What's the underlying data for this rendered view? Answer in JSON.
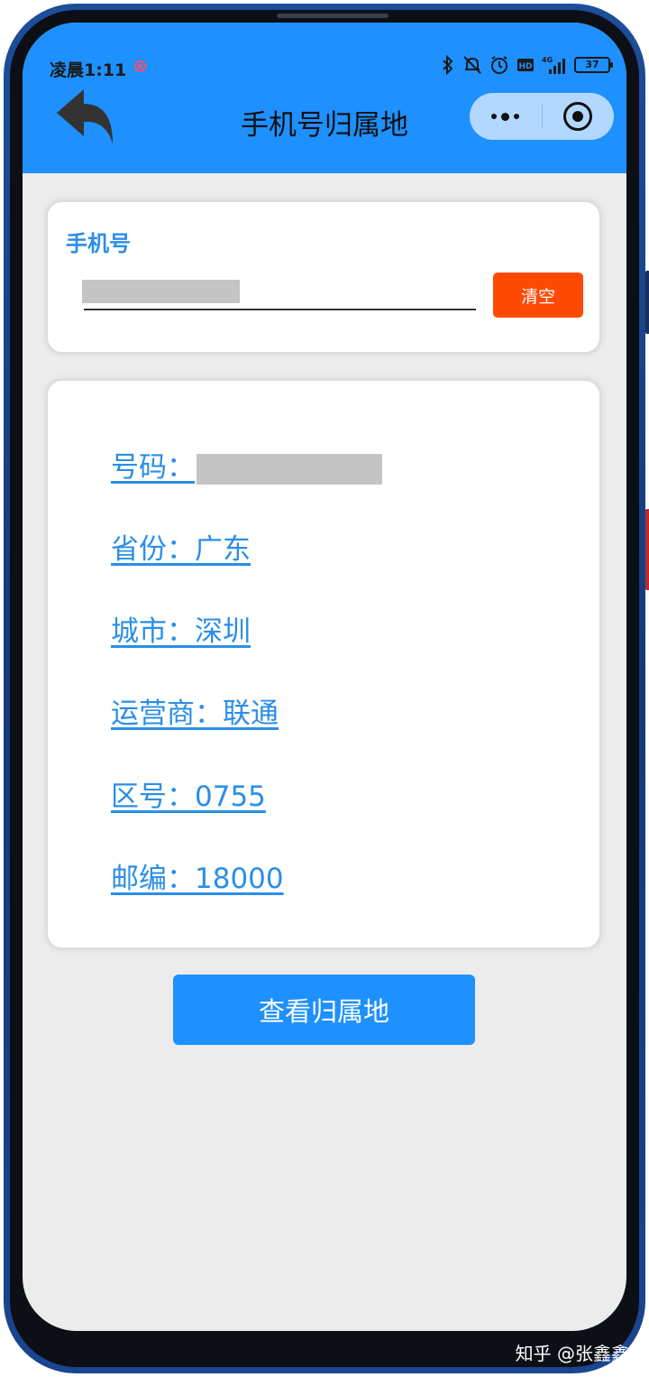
{
  "status_bar": {
    "time": "凌晨1:11",
    "battery": "37",
    "network": "4G",
    "icons": [
      "bluetooth-icon",
      "bell-off-icon",
      "alarm-icon",
      "hd-icon",
      "signal-icon",
      "battery-icon"
    ]
  },
  "nav": {
    "title": "手机号归属地",
    "back_icon": "back-arrow-icon",
    "more_icon": "more-dots-icon",
    "close_icon": "target-icon"
  },
  "input_section": {
    "label": "手机号",
    "input_value": "",
    "clear_label": "清空"
  },
  "result": {
    "number_label": "号码：",
    "province": "省份：广东",
    "city": "城市：深圳",
    "carrier": "运营商：联通",
    "area_code": "区号：0755",
    "zip_code": "邮编：18000"
  },
  "query_button": "查看归属地",
  "watermark": "知乎 @张鑫鑫",
  "colors": {
    "primary": "#1e90ff",
    "clear_button": "#ff4a05",
    "link_text": "#2b8ee6",
    "background": "#ececec",
    "frame": "#1d4e9a"
  }
}
